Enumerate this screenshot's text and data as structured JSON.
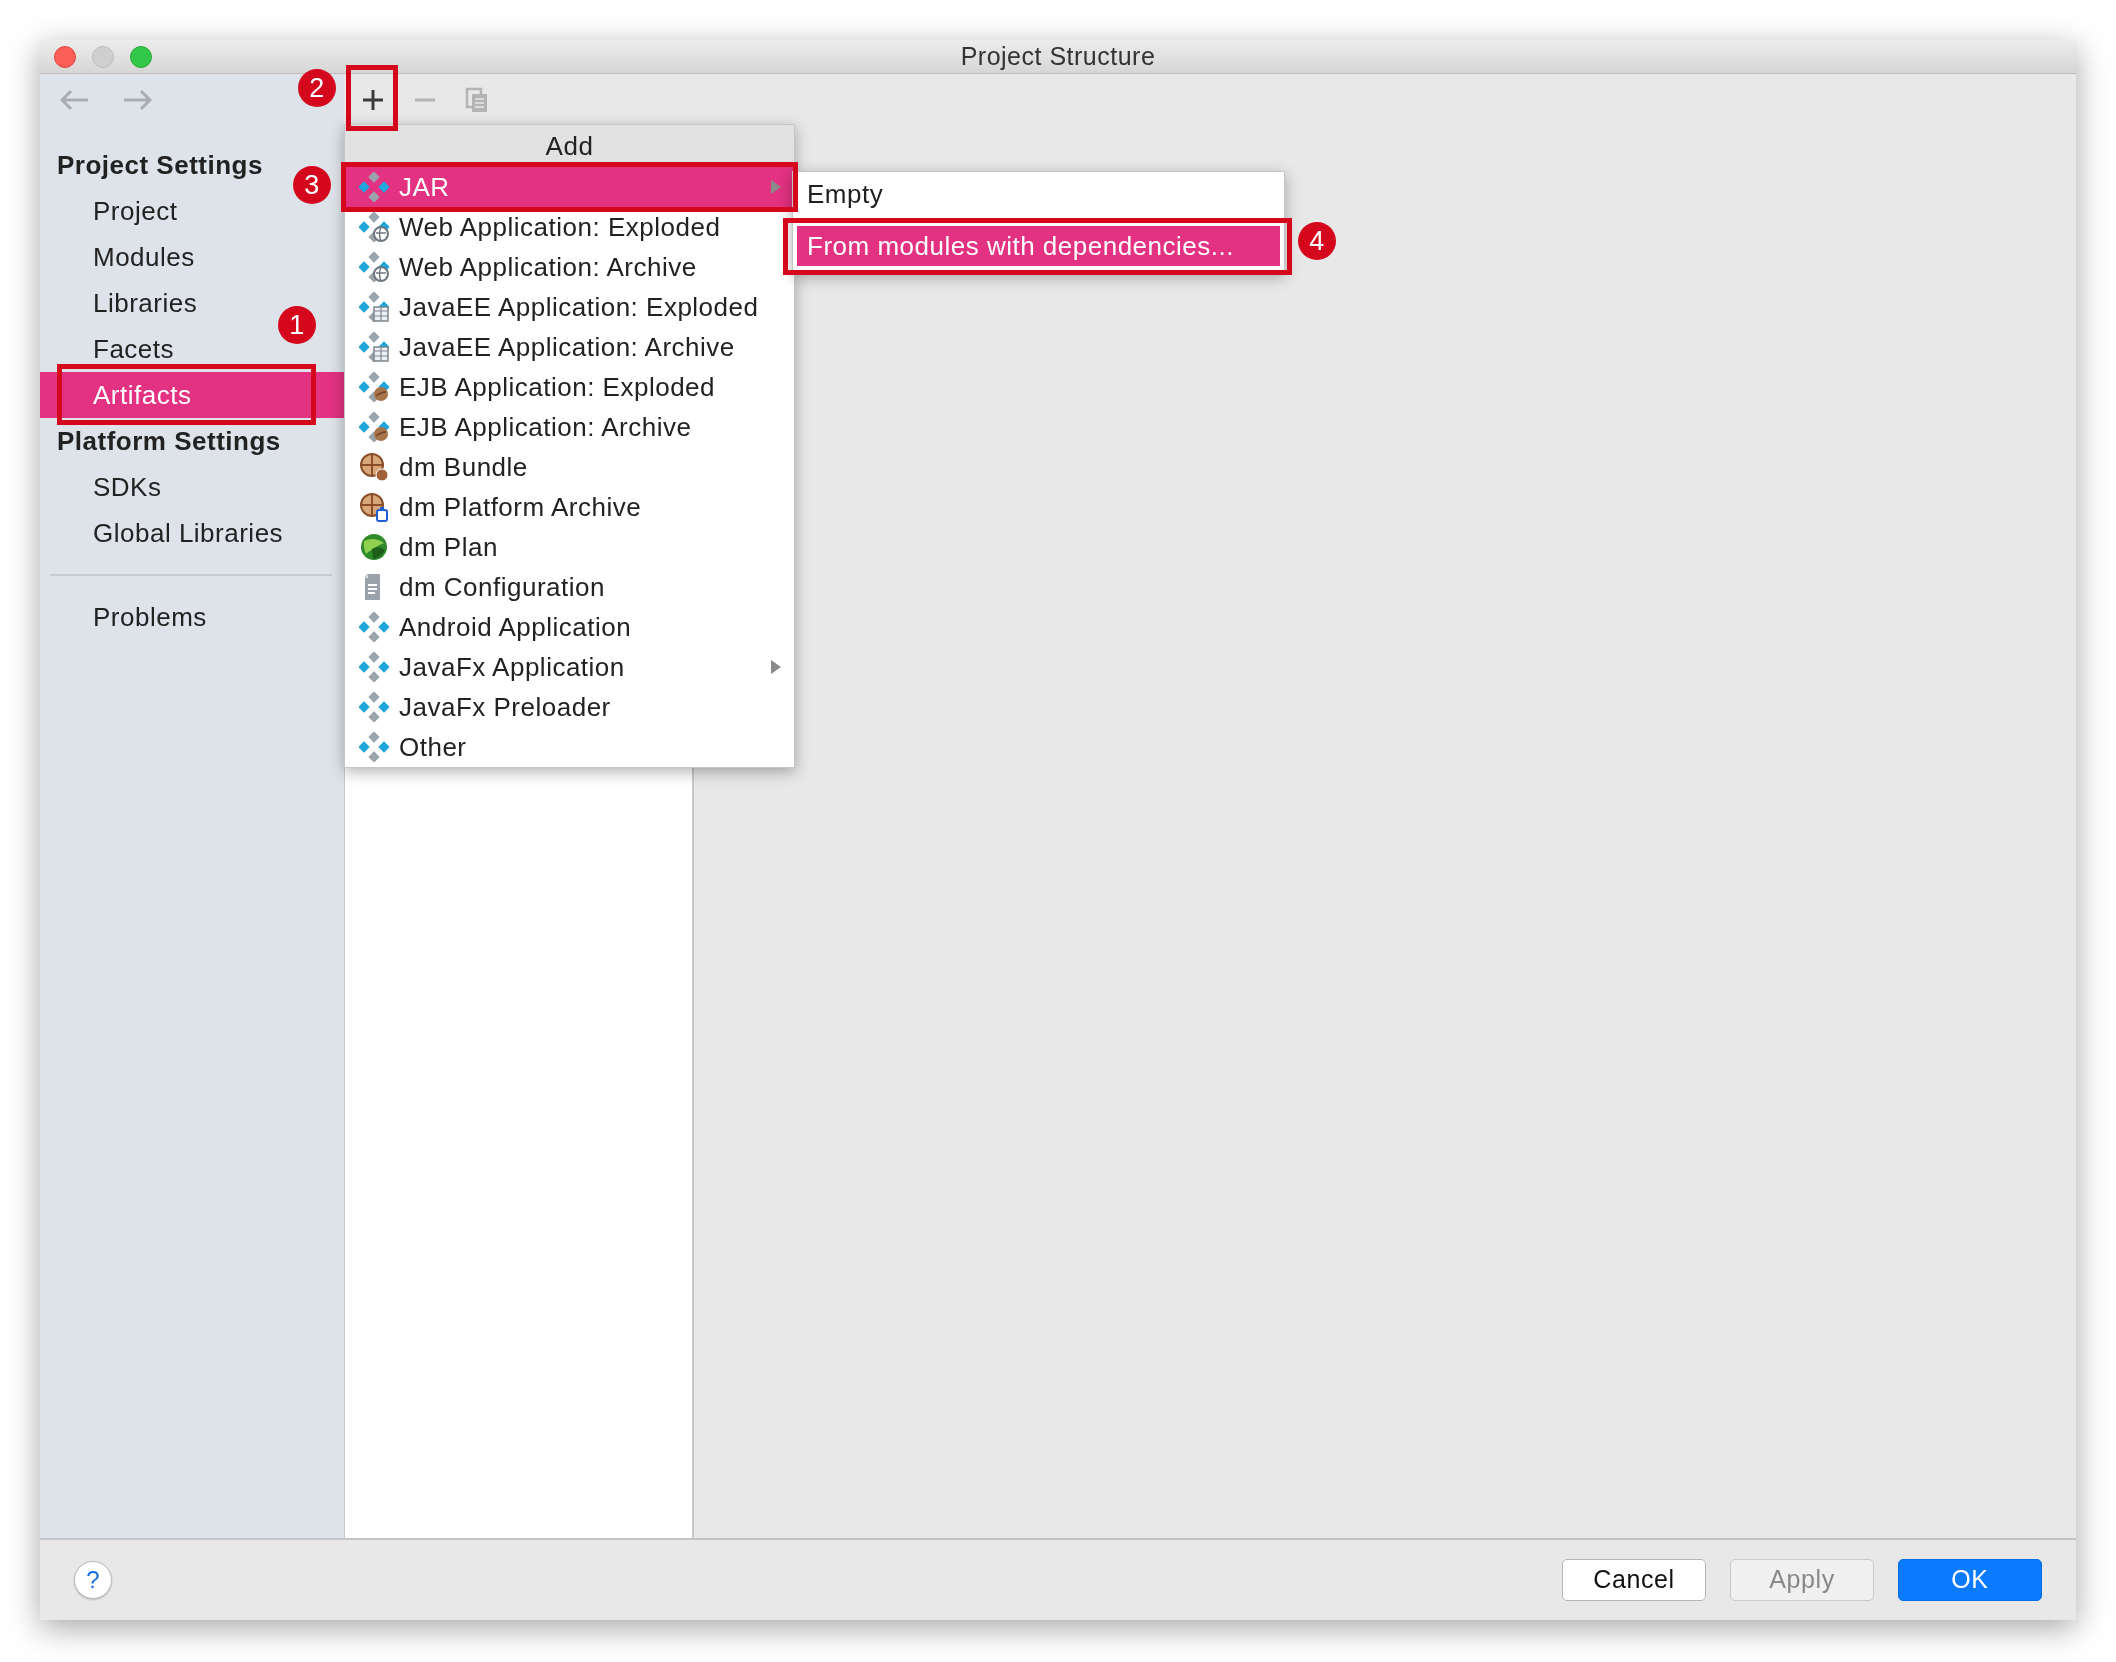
{
  "window": {
    "title": "Project Structure"
  },
  "navigation": [
    {
      "kind": "back",
      "disabled": true
    },
    {
      "kind": "forward",
      "disabled": true
    }
  ],
  "toolbar": [
    {
      "kind": "add",
      "disabled": false,
      "callout": "2"
    },
    {
      "kind": "remove",
      "disabled": true
    },
    {
      "kind": "copy",
      "disabled": true
    }
  ],
  "sidebar": {
    "sections": [
      {
        "title": "Project Settings",
        "items": [
          {
            "label": "Project",
            "selected": false
          },
          {
            "label": "Modules",
            "selected": false
          },
          {
            "label": "Libraries",
            "selected": false
          },
          {
            "label": "Facets",
            "selected": false
          },
          {
            "label": "Artifacts",
            "selected": true,
            "callout": "1"
          }
        ]
      },
      {
        "title": "Platform Settings",
        "items": [
          {
            "label": "SDKs",
            "selected": false
          },
          {
            "label": "Global Libraries",
            "selected": false
          }
        ]
      }
    ],
    "footer_items": [
      {
        "label": "Problems",
        "selected": false
      }
    ]
  },
  "add_menu": {
    "title": "Add",
    "items": [
      {
        "label": "JAR",
        "kind": "artifact",
        "selected": true,
        "has_submenu": true,
        "callout": "3"
      },
      {
        "label": "Web Application: Exploded",
        "kind": "web",
        "selected": false,
        "has_submenu": false
      },
      {
        "label": "Web Application: Archive",
        "kind": "web",
        "selected": false,
        "has_submenu": false
      },
      {
        "label": "JavaEE Application: Exploded",
        "kind": "javaee",
        "selected": false,
        "has_submenu": false
      },
      {
        "label": "JavaEE Application: Archive",
        "kind": "javaee",
        "selected": false,
        "has_submenu": false
      },
      {
        "label": "EJB Application: Exploded",
        "kind": "ejb",
        "selected": false,
        "has_submenu": false
      },
      {
        "label": "EJB Application: Archive",
        "kind": "ejb",
        "selected": false,
        "has_submenu": false
      },
      {
        "label": "dm Bundle",
        "kind": "bundle",
        "selected": false,
        "has_submenu": false
      },
      {
        "label": "dm Platform Archive",
        "kind": "platform",
        "selected": false,
        "has_submenu": false
      },
      {
        "label": "dm Plan",
        "kind": "plan",
        "selected": false,
        "has_submenu": false
      },
      {
        "label": "dm Configuration",
        "kind": "configuration",
        "selected": false,
        "has_submenu": false
      },
      {
        "label": "Android Application",
        "kind": "artifact",
        "selected": false,
        "has_submenu": false
      },
      {
        "label": "JavaFx Application",
        "kind": "artifact",
        "selected": false,
        "has_submenu": true
      },
      {
        "label": "JavaFx Preloader",
        "kind": "artifact",
        "selected": false,
        "has_submenu": false
      },
      {
        "label": "Other",
        "kind": "artifact",
        "selected": false,
        "has_submenu": false
      }
    ]
  },
  "submenu": {
    "items": [
      {
        "label": "Empty",
        "selected": false
      },
      {
        "label": "From modules with dependencies...",
        "selected": true,
        "callout": "4"
      }
    ]
  },
  "help_button": {
    "label": "?"
  },
  "buttons": [
    {
      "label": "Cancel",
      "kind": "default",
      "disabled": false
    },
    {
      "label": "Apply",
      "kind": "default",
      "disabled": true
    },
    {
      "label": "OK",
      "kind": "primary",
      "disabled": false
    }
  ]
}
